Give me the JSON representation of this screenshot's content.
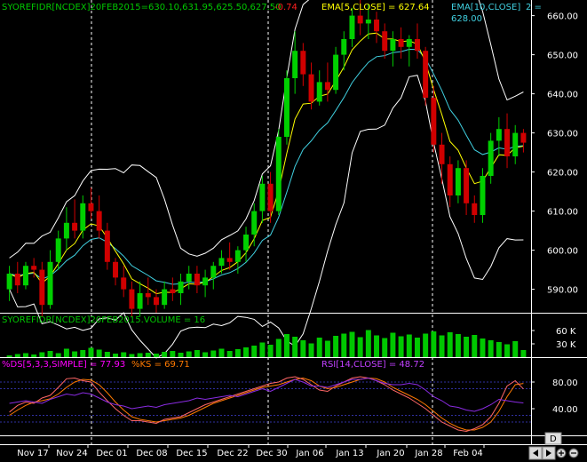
{
  "colors": {
    "background": "#000000",
    "up_candle": "#00d000",
    "down_candle": "#d00000",
    "bands": "#ffffff",
    "ema5": "#ffff00",
    "ema10": "#40d0e0",
    "volume": "#00c800",
    "ds": "#ff7a00",
    "ks": "#ff6666",
    "rsi": "#8a2be2",
    "ref_line": "#3030a0",
    "axis_text": "#ffffff"
  },
  "price_panel": {
    "title_prefix": "SYOREFIDR[NCDEX]20FEB2015=630.10,631.95,625.50,627.50",
    "change": "-0.74",
    "ema5_label": "EMA[5,CLOSE] = 627.64",
    "ema10_label_line1": "EMA[10,CLOSE]",
    "ema10_label_num": "2 =",
    "ema10_label_line2": "628.00",
    "y_ticks": [
      "660.00",
      "650.00",
      "640.00",
      "630.00",
      "620.00",
      "610.00",
      "600.00",
      "590.00"
    ]
  },
  "volume_panel": {
    "title": "SYOREFIDR[NCDEX]20FEB2015.VOLUME = 16",
    "y_ticks": [
      "60 K",
      "30 K"
    ]
  },
  "osc_panel": {
    "ds_label": "%DS[5,3,3,SIMPLE] = 77.93",
    "ks_label": "%KS = 69.71",
    "rsi_label": "RSI[14,CLOSE] = 48.72",
    "y_ticks": [
      "80.00",
      "40.00"
    ]
  },
  "x_axis": {
    "labels": [
      "Nov 17",
      "Nov 24",
      "Dec 01",
      "Dec 08",
      "Dec 15",
      "Dec 22",
      "Dec 30",
      "Jan 06",
      "Jan 13",
      "Jan 20",
      "Jan 28",
      "Feb 04"
    ]
  },
  "corner_button": "D",
  "scroll_buttons": [
    "left-arrow-icon",
    "right-arrow-icon",
    "zoom-in-icon",
    "zoom-out-icon"
  ],
  "chart_data": [
    {
      "type": "candlestick",
      "ylim": [
        584,
        664
      ],
      "candles": [
        [
          590,
          596,
          587,
          594
        ],
        [
          594,
          597,
          589,
          591
        ],
        [
          591,
          597,
          590,
          596
        ],
        [
          596,
          598,
          593,
          595
        ],
        [
          595,
          597,
          583,
          586
        ],
        [
          586,
          600,
          585,
          597
        ],
        [
          597,
          605,
          595,
          603
        ],
        [
          603,
          611,
          600,
          607
        ],
        [
          607,
          613,
          603,
          605
        ],
        [
          605,
          614,
          603,
          612
        ],
        [
          612,
          616,
          608,
          610
        ],
        [
          610,
          614,
          603,
          605
        ],
        [
          605,
          607,
          595,
          597
        ],
        [
          597,
          598,
          591,
          593
        ],
        [
          593,
          596,
          588,
          590
        ],
        [
          590,
          592,
          583,
          585
        ],
        [
          585,
          592,
          583,
          589
        ],
        [
          589,
          593,
          586,
          588
        ],
        [
          588,
          590,
          584,
          586
        ],
        [
          586,
          592,
          585,
          590
        ],
        [
          590,
          593,
          587,
          589
        ],
        [
          589,
          594,
          586,
          592
        ],
        [
          592,
          596,
          590,
          594
        ],
        [
          594,
          596,
          589,
          591
        ],
        [
          591,
          595,
          588,
          593
        ],
        [
          593,
          597,
          590,
          596
        ],
        [
          596,
          600,
          594,
          598
        ],
        [
          598,
          602,
          595,
          597
        ],
        [
          597,
          601,
          594,
          600
        ],
        [
          600,
          606,
          597,
          604
        ],
        [
          604,
          612,
          601,
          610
        ],
        [
          610,
          619,
          607,
          617
        ],
        [
          617,
          620,
          607,
          610
        ],
        [
          610,
          631,
          609,
          629
        ],
        [
          629,
          646,
          627,
          644
        ],
        [
          644,
          656,
          640,
          651
        ],
        [
          651,
          653,
          642,
          645
        ],
        [
          645,
          648,
          636,
          638
        ],
        [
          638,
          646,
          637,
          643
        ],
        [
          643,
          648,
          638,
          641
        ],
        [
          641,
          652,
          640,
          650
        ],
        [
          650,
          656,
          646,
          654
        ],
        [
          654,
          662,
          652,
          660
        ],
        [
          660,
          665,
          655,
          658
        ],
        [
          658,
          663,
          654,
          659
        ],
        [
          659,
          661,
          653,
          656
        ],
        [
          656,
          658,
          649,
          651
        ],
        [
          651,
          656,
          647,
          654
        ],
        [
          654,
          657,
          649,
          652
        ],
        [
          652,
          655,
          647,
          654
        ],
        [
          654,
          658,
          649,
          651
        ],
        [
          651,
          652,
          637,
          639
        ],
        [
          639,
          642,
          625,
          627
        ],
        [
          627,
          630,
          617,
          622
        ],
        [
          622,
          624,
          611,
          614
        ],
        [
          614,
          623,
          612,
          621
        ],
        [
          621,
          623,
          609,
          612
        ],
        [
          612,
          614,
          607,
          609
        ],
        [
          609,
          621,
          607,
          619
        ],
        [
          619,
          630,
          617,
          628
        ],
        [
          628,
          634,
          624,
          631
        ],
        [
          631,
          635,
          621,
          624
        ],
        [
          624,
          632,
          622,
          630
        ],
        [
          630,
          631,
          625,
          627.5
        ]
      ]
    },
    {
      "type": "bar",
      "name": "VOLUME",
      "ylim": [
        0,
        70000
      ],
      "values": [
        4000,
        7000,
        9000,
        6000,
        11000,
        14000,
        9000,
        19000,
        13000,
        16000,
        21000,
        17000,
        12000,
        8000,
        11000,
        7000,
        9000,
        10000,
        8000,
        12000,
        14000,
        10000,
        13000,
        16000,
        11000,
        15000,
        19000,
        14000,
        18000,
        22000,
        26000,
        33000,
        28000,
        41000,
        52000,
        46000,
        38000,
        31000,
        44000,
        37000,
        48000,
        53000,
        57000,
        45000,
        61000,
        49000,
        43000,
        55000,
        47000,
        51000,
        44000,
        53000,
        58000,
        49000,
        56000,
        52000,
        46000,
        50000,
        42000,
        38000,
        34000,
        29000,
        36000,
        16000
      ]
    },
    {
      "type": "line",
      "ylim": [
        0,
        100
      ],
      "series": [
        {
          "name": "%DS[5,3,3,SIMPLE]",
          "values": [
            30,
            38,
            45,
            50,
            52,
            55,
            62,
            72,
            80,
            84,
            83,
            76,
            64,
            50,
            38,
            28,
            24,
            22,
            20,
            22,
            24,
            26,
            30,
            36,
            42,
            48,
            52,
            56,
            60,
            64,
            68,
            72,
            74,
            76,
            80,
            84,
            86,
            82,
            74,
            70,
            72,
            76,
            80,
            84,
            86,
            85,
            80,
            72,
            66,
            60,
            54,
            46,
            36,
            26,
            18,
            12,
            8,
            8,
            12,
            20,
            36,
            58,
            76,
            77.93
          ]
        },
        {
          "name": "%KS",
          "values": [
            35,
            45,
            50,
            48,
            56,
            60,
            72,
            85,
            86,
            82,
            80,
            65,
            52,
            40,
            30,
            22,
            22,
            20,
            18,
            24,
            26,
            28,
            34,
            40,
            46,
            50,
            54,
            58,
            62,
            66,
            70,
            74,
            78,
            80,
            86,
            88,
            84,
            76,
            68,
            66,
            74,
            80,
            86,
            88,
            86,
            82,
            76,
            68,
            62,
            56,
            48,
            40,
            30,
            20,
            14,
            8,
            6,
            10,
            16,
            28,
            48,
            74,
            82,
            69.71
          ]
        },
        {
          "name": "RSI[14,CLOSE]",
          "values": [
            48,
            50,
            52,
            50,
            48,
            54,
            58,
            62,
            60,
            64,
            62,
            56,
            50,
            46,
            44,
            40,
            42,
            44,
            42,
            46,
            48,
            50,
            52,
            56,
            54,
            56,
            58,
            60,
            58,
            62,
            66,
            70,
            66,
            72,
            78,
            84,
            80,
            74,
            74,
            72,
            76,
            80,
            84,
            84,
            86,
            82,
            78,
            76,
            76,
            78,
            76,
            68,
            58,
            52,
            44,
            42,
            38,
            36,
            40,
            46,
            54,
            52,
            50,
            48.72
          ]
        }
      ]
    }
  ]
}
